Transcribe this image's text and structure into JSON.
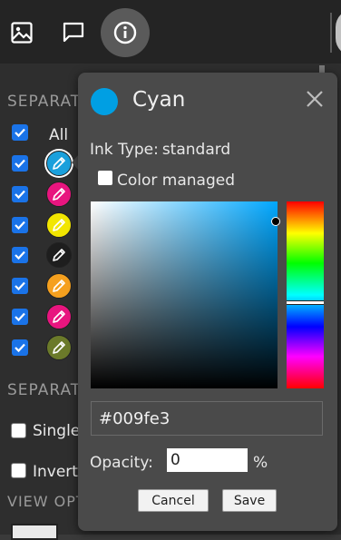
{
  "toolbar": {
    "image_icon": "image-icon",
    "comment_icon": "comment-icon",
    "info_icon": "info-icon"
  },
  "separations": {
    "header": "SEPARATIONS",
    "all_label": "All",
    "items": [
      {
        "color": "#1aa0dc",
        "checked": true,
        "selected": true
      },
      {
        "color": "#e8157f",
        "checked": true
      },
      {
        "color": "#f2e600",
        "checked": true
      },
      {
        "color": "#1e1e1e",
        "checked": true
      },
      {
        "color": "#f5a01e",
        "checked": true
      },
      {
        "color": "#e8157f",
        "checked": true
      },
      {
        "color": "#6b7a2a",
        "checked": true
      }
    ]
  },
  "second_section": {
    "header": "SEPARATIONS",
    "single_label": "Single",
    "invert_label": "Invert"
  },
  "view_section": {
    "header": "VIEW OPTIONS"
  },
  "color_popup": {
    "title": "Cyan",
    "swatch_color": "#009fe3",
    "ink_type_label": "Ink Type:",
    "ink_type_value": "standard",
    "color_managed_label": "Color managed",
    "color_managed_checked": false,
    "hex_value": "#009fe3",
    "opacity_label": "Opacity:",
    "opacity_value": "0",
    "opacity_unit": "%",
    "cancel_label": "Cancel",
    "save_label": "Save"
  }
}
